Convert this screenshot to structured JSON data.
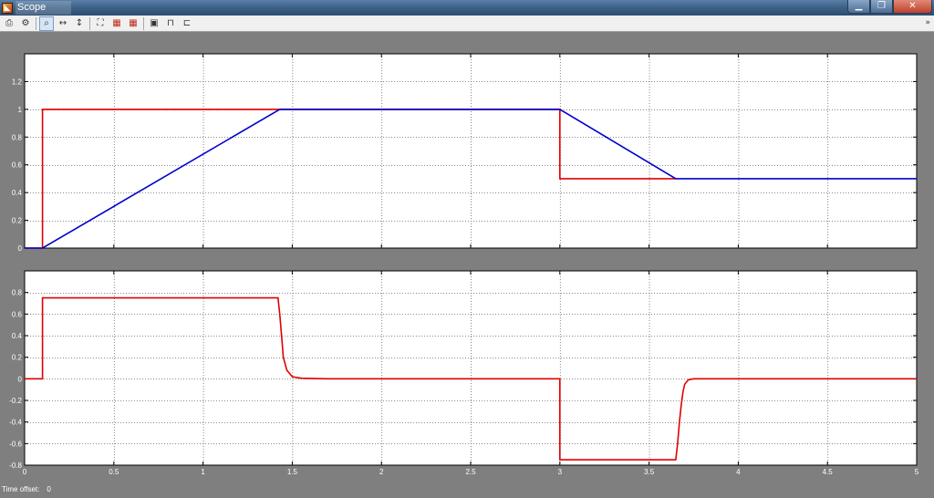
{
  "window": {
    "title": "Scope",
    "icon": "matlab-scope-icon",
    "controls": [
      "minimize-icon",
      "maximize-icon",
      "close-icon"
    ]
  },
  "toolbar": {
    "buttons": [
      {
        "name": "print-icon",
        "glyph": "⎙"
      },
      {
        "name": "parameters-icon",
        "glyph": "⚙"
      },
      {
        "name": "zoom-icon",
        "glyph": "⌕",
        "active": true
      },
      {
        "name": "zoom-x-icon",
        "glyph": "↔"
      },
      {
        "name": "zoom-y-icon",
        "glyph": "↕"
      },
      {
        "name": "autoscale-icon",
        "glyph": "⛶"
      },
      {
        "name": "save-axes-settings-icon",
        "glyph": "▦"
      },
      {
        "name": "restore-axes-settings-icon",
        "glyph": "▦"
      },
      {
        "name": "floating-scope-icon",
        "glyph": "▣"
      },
      {
        "name": "lock-axes-icon",
        "glyph": "🔒"
      },
      {
        "name": "signal-selector-icon",
        "glyph": "⊏"
      }
    ]
  },
  "footer": {
    "time_offset_label": "Time offset:",
    "time_offset_value": "0"
  },
  "colors": {
    "background": "#7f7f7f",
    "axes_bg": "#ffffff",
    "series_red": "#e00000",
    "series_blue": "#0000cc",
    "grid": "#666666"
  },
  "chart_data": [
    {
      "type": "line",
      "title": "",
      "xlabel": "",
      "ylabel": "",
      "xlim": [
        0,
        5
      ],
      "ylim": [
        0,
        1.4
      ],
      "xticks": [
        0,
        0.5,
        1,
        1.5,
        2,
        2.5,
        3,
        3.5,
        4,
        4.5,
        5
      ],
      "xtick_labels": [
        "",
        "",
        "",
        "",
        "",
        "",
        "",
        "",
        "",
        "",
        ""
      ],
      "yticks": [
        0,
        0.2,
        0.4,
        0.6,
        0.8,
        1,
        1.2
      ],
      "ytick_labels": [
        "0",
        "0.2",
        "0.4",
        "0.6",
        "0.8",
        "1",
        "1.2"
      ],
      "grid": true,
      "series": [
        {
          "color": "#e00000",
          "x": [
            0,
            0.1,
            0.1,
            3.0,
            3.0,
            3.65
          ],
          "y": [
            0,
            0,
            1,
            1,
            0.5,
            0.5
          ]
        },
        {
          "color": "#0000cc",
          "x": [
            0,
            0.1,
            1.43,
            3.0,
            3.65,
            5
          ],
          "y": [
            0,
            0,
            1,
            1,
            0.5,
            0.5
          ]
        }
      ]
    },
    {
      "type": "line",
      "title": "",
      "xlabel": "",
      "ylabel": "",
      "xlim": [
        0,
        5
      ],
      "ylim": [
        -0.8,
        1.0
      ],
      "xticks": [
        0,
        0.5,
        1,
        1.5,
        2,
        2.5,
        3,
        3.5,
        4,
        4.5,
        5
      ],
      "xtick_labels": [
        "0",
        "0.5",
        "1",
        "1.5",
        "2",
        "2.5",
        "3",
        "3.5",
        "4",
        "4.5",
        "5"
      ],
      "yticks": [
        -0.8,
        -0.6,
        -0.4,
        -0.2,
        0,
        0.2,
        0.4,
        0.6,
        0.8
      ],
      "ytick_labels": [
        "-0.8",
        "-0.6",
        "-0.4",
        "-0.2",
        "0",
        "0.2",
        "0.4",
        "0.6",
        "0.8"
      ],
      "grid": true,
      "series": [
        {
          "color": "#e00000",
          "x": [
            0,
            0.1,
            0.1,
            1.42,
            1.43,
            1.44,
            1.45,
            1.47,
            1.5,
            1.55,
            1.7,
            3.0,
            3.0,
            3.65,
            3.66,
            3.67,
            3.68,
            3.69,
            3.7,
            3.72,
            3.75,
            3.8,
            5
          ],
          "y": [
            0,
            0,
            0.75,
            0.75,
            0.6,
            0.4,
            0.2,
            0.08,
            0.02,
            0.005,
            0,
            0,
            -0.75,
            -0.75,
            -0.6,
            -0.4,
            -0.25,
            -0.12,
            -0.05,
            -0.01,
            0,
            0,
            0
          ]
        }
      ]
    }
  ]
}
